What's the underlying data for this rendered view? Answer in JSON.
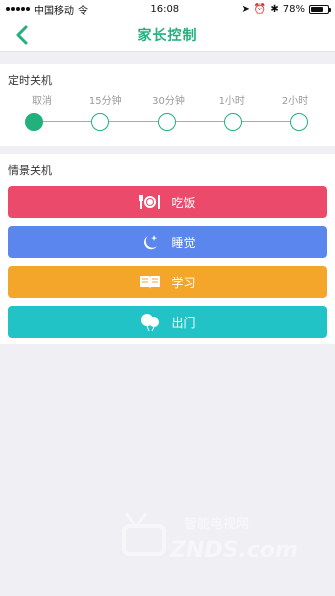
{
  "status_bar": {
    "carrier": "中国移动",
    "network": "令",
    "time": "16:08",
    "battery_percent": "78%",
    "battery_level": 0.78
  },
  "header": {
    "title": "家长控制",
    "back_icon": "chevron-left-icon"
  },
  "timer_section": {
    "title": "定时关机",
    "selected_index": 0,
    "options": [
      {
        "label": "取消"
      },
      {
        "label": "15分钟"
      },
      {
        "label": "30分钟"
      },
      {
        "label": "1小时"
      },
      {
        "label": "2小时"
      }
    ]
  },
  "scene_section": {
    "title": "情景关机",
    "buttons": [
      {
        "label": "吃饭",
        "icon": "dining-icon",
        "color": "#ec4a6b"
      },
      {
        "label": "睡觉",
        "icon": "moon-star-icon",
        "color": "#5b86ee"
      },
      {
        "label": "学习",
        "icon": "book-icon",
        "color": "#f4a62a"
      },
      {
        "label": "出门",
        "icon": "balloon-icon",
        "color": "#21c3c7"
      }
    ]
  },
  "colors": {
    "accent": "#22b07d",
    "background": "#efeff4"
  },
  "watermark": {
    "text_cn": "智能电视网",
    "text_en": "ZNDS.com"
  }
}
